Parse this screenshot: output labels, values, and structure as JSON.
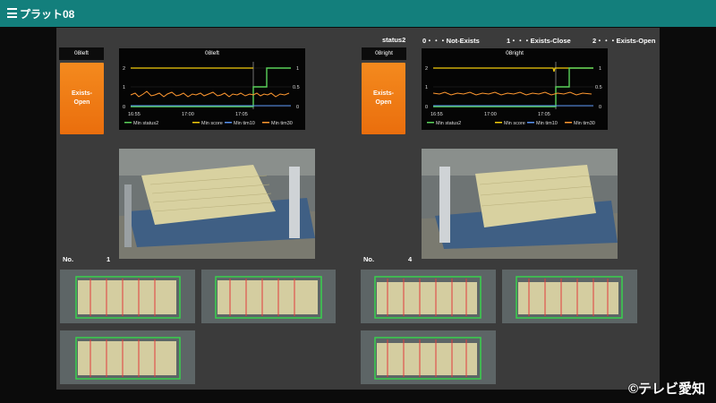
{
  "app": {
    "title": "プラット08"
  },
  "legend": {
    "label": "status2",
    "items": [
      "0・・・Not-Exists",
      "1・・・Exists-Close",
      "2・・・Exists-Open"
    ]
  },
  "left": {
    "label": "08left",
    "status": "Exists-Open",
    "chart": {
      "title": "08left",
      "yleft": [
        "2",
        "1",
        "0"
      ],
      "yright": [
        "1",
        "0.5",
        "0"
      ],
      "xticks": [
        "16:55",
        "17:00",
        "17:05"
      ],
      "legend": [
        "Min status2",
        "Min score",
        "Min tim10",
        "Min tim30"
      ]
    },
    "no_label": "No.",
    "no_value": "1"
  },
  "right": {
    "label": "08right",
    "status": "Exists-Open",
    "chart": {
      "title": "08right",
      "yleft": [
        "2",
        "1",
        "0"
      ],
      "yright": [
        "1",
        "0.5",
        "0"
      ],
      "xticks": [
        "16:55",
        "17:00",
        "17:05"
      ],
      "legend": [
        "Min status2",
        "Min score",
        "Min tim10",
        "Min tim30"
      ]
    },
    "no_label": "No.",
    "no_value": "4"
  },
  "colors": {
    "status2": "#5ad15a",
    "score": "#f2cc0c",
    "tim10": "#5794f2",
    "tim30": "#ff9830",
    "status_box": "#f07a14",
    "header": "#137f7c"
  },
  "watermark": "©テレビ愛知"
}
